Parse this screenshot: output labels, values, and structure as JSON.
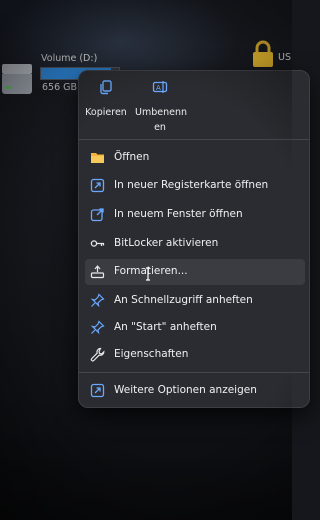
{
  "drive": {
    "name": "Volume (D:)",
    "size": "656 GB",
    "usage_fraction": 0.9
  },
  "usb": {
    "label": "US"
  },
  "quick_actions": [
    {
      "label": "Kopieren",
      "icon": "copy-icon"
    },
    {
      "label": "Umbenenn\nen",
      "icon": "rename-icon"
    }
  ],
  "menu_items": [
    {
      "label": "Öffnen",
      "icon": "folder-icon"
    },
    {
      "label": "In neuer Registerkarte öffnen",
      "icon": "new-tab-icon"
    },
    {
      "label": "In neuem Fenster öffnen",
      "icon": "new-window-icon"
    },
    {
      "label": "BitLocker aktivieren",
      "icon": "key-icon"
    },
    {
      "label": "Formatieren...",
      "icon": "format-icon"
    },
    {
      "label": "An Schnellzugriff anheften",
      "icon": "pin-icon"
    },
    {
      "label": "An \"Start\" anheften",
      "icon": "pin-icon"
    },
    {
      "label": "Eigenschaften",
      "icon": "wrench-icon"
    }
  ],
  "more_options": {
    "label": "Weitere Optionen anzeigen",
    "icon": "more-options-icon"
  },
  "colors": {
    "accent": "#5aa0ff",
    "menu_bg": "#2b2c31",
    "drive_bar": "#2f8be0",
    "folder": "#f2b53a"
  }
}
